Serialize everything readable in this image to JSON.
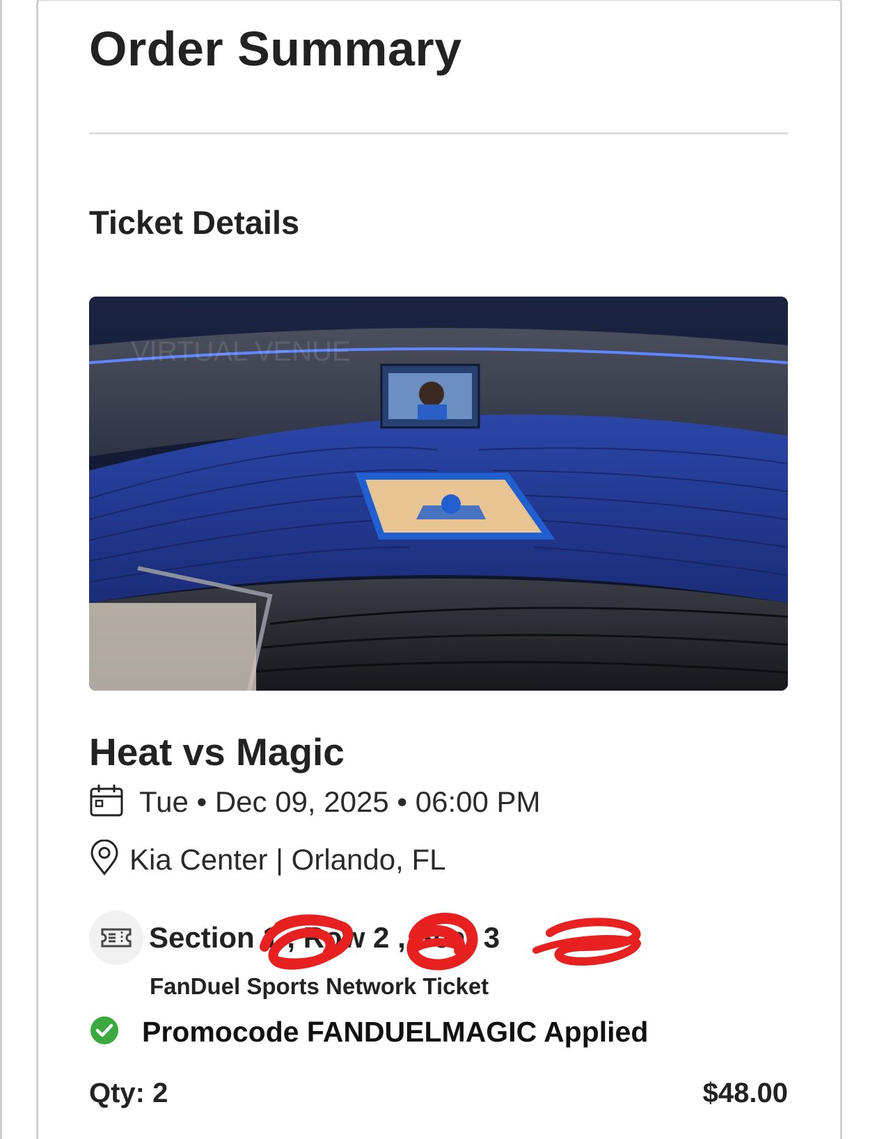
{
  "header": {
    "title": "Order Summary"
  },
  "ticket_details": {
    "heading": "Ticket Details",
    "image": {
      "description": "arena-seat-view",
      "watermark": "VIRTUAL VENUE"
    },
    "event_name": "Heat vs Magic",
    "datetime": "Tue • Dec 09, 2025 • 06:00 PM",
    "location": "Kia Center | Orlando, FL",
    "seat_info": "Section 1 , Row 2 , Seat 3",
    "ticket_type": "FanDuel Sports Network Ticket",
    "promo": "Promocode FANDUELMAGIC Applied"
  },
  "summary": {
    "qty": "Qty: 2",
    "price": "$48.00"
  },
  "icons": {
    "date": "calendar-icon",
    "location": "map-pin-icon",
    "seat": "ticket-icon",
    "promo": "check-circle-icon"
  },
  "colors": {
    "redaction": "#e8201f",
    "promo_check": "#3aaa3f",
    "court_blue": "#1f5fd0",
    "court_wood": "#e8c493"
  }
}
